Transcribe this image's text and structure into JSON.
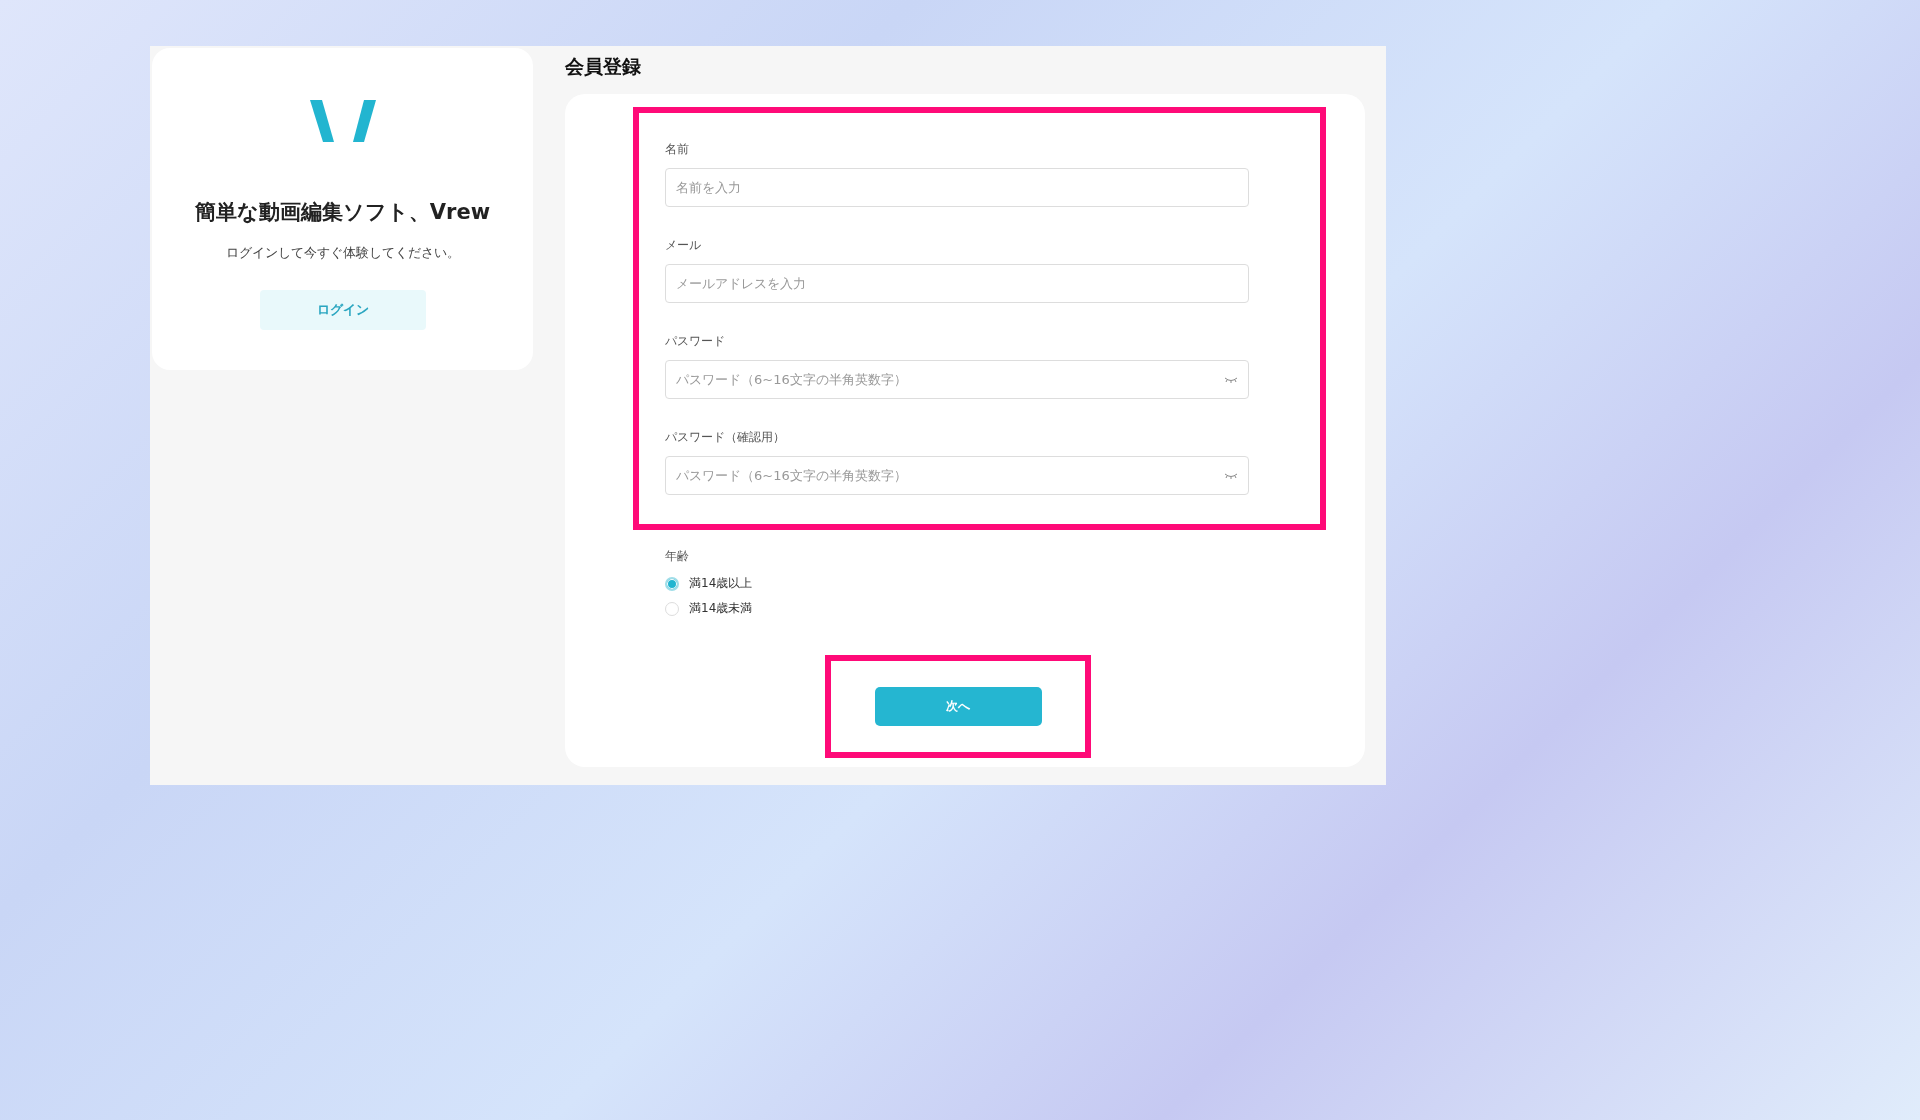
{
  "intro": {
    "title": "簡単な動画編集ソフト、Vrew",
    "subtitle": "ログインして今すぐ体験してください。",
    "login_button": "ログイン"
  },
  "signup": {
    "title": "会員登録",
    "fields": [
      {
        "label": "名前",
        "placeholder": "名前を入力",
        "kind": "text"
      },
      {
        "label": "メール",
        "placeholder": "メールアドレスを入力",
        "kind": "text"
      },
      {
        "label": "パスワード",
        "placeholder": "パスワード（6~16文字の半角英数字）",
        "kind": "password"
      },
      {
        "label": "パスワード（確認用）",
        "placeholder": "パスワード（6~16文字の半角英数字）",
        "kind": "password"
      }
    ],
    "age": {
      "label": "年齢",
      "options": [
        {
          "label": "満14歳以上",
          "selected": true
        },
        {
          "label": "満14歳未満",
          "selected": false
        }
      ]
    },
    "next_button": "次へ"
  }
}
